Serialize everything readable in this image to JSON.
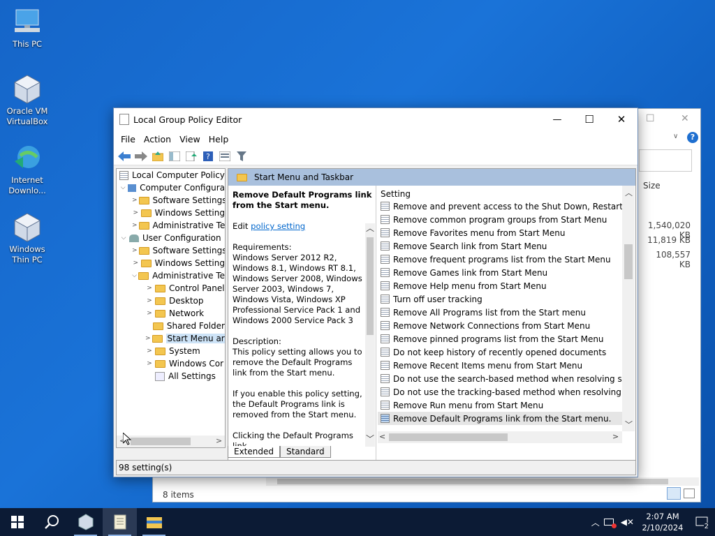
{
  "desktop_icons": [
    {
      "label1": "This PC",
      "label2": ""
    },
    {
      "label1": "Oracle VM",
      "label2": "VirtualBox"
    },
    {
      "label1": "Internet",
      "label2": "Downlo..."
    },
    {
      "label1": "Windows",
      "label2": "Thin PC"
    }
  ],
  "bg_window": {
    "col_size": "Size",
    "sizes": [
      "1,540,020 KB",
      "11,819 KB",
      "108,557 KB"
    ],
    "status": "8 items"
  },
  "window": {
    "title": "Local Group Policy Editor",
    "min": "—",
    "max": "☐",
    "close": "✕"
  },
  "menu": [
    "File",
    "Action",
    "View",
    "Help"
  ],
  "tree": {
    "root": "Local Computer Policy",
    "computer": "Computer Configura",
    "c_sw": "Software Settings",
    "c_win": "Windows Setting",
    "c_adm": "Administrative Te",
    "user": "User Configuration",
    "u_sw": "Software Settings",
    "u_win": "Windows Setting",
    "u_adm": "Administrative Te",
    "children": [
      "Control Panel",
      "Desktop",
      "Network",
      "Shared Folder",
      "Start Menu ar",
      "System",
      "Windows Cor",
      "All Settings"
    ]
  },
  "pane": {
    "header": "Start Menu and Taskbar",
    "desc_title": "Remove Default Programs link from the Start menu.",
    "edit_prefix": "Edit ",
    "edit_link": "policy setting",
    "req_label": "Requirements:",
    "requirements": "Windows Server 2012 R2, Windows 8.1, Windows RT 8.1, Windows Server 2008, Windows Server 2003, Windows 7, Windows Vista, Windows XP Professional Service Pack 1 and Windows 2000 Service Pack 3",
    "desc_label": "Description:",
    "description": "This policy setting allows you to remove the Default Programs link from the Start menu.",
    "enable_text": "If you enable this policy setting, the Default Programs link is removed from the Start menu.",
    "click_text": "Clicking the Default Programs link",
    "col_setting": "Setting",
    "settings": [
      "Remove and prevent access to the Shut Down, Restart, Sleep...",
      "Remove common program groups from Start Menu",
      "Remove Favorites menu from Start Menu",
      "Remove Search link from Start Menu",
      "Remove frequent programs list from the Start Menu",
      "Remove Games link from Start Menu",
      "Remove Help menu from Start Menu",
      "Turn off user tracking",
      "Remove All Programs list from the Start menu",
      "Remove Network Connections from Start Menu",
      "Remove pinned programs list from the Start Menu",
      "Do not keep history of recently opened documents",
      "Remove Recent Items menu from Start Menu",
      "Do not use the search-based method when resolving shell s...",
      "Do not use the tracking-based method when resolving shell ...",
      "Remove Run menu from Start Menu",
      "Remove Default Programs link from the Start menu."
    ],
    "selected_index": 16,
    "tab_extended": "Extended",
    "tab_standard": "Standard"
  },
  "status": "98 setting(s)",
  "taskbar": {
    "time": "2:07 AM",
    "date": "2/10/2024",
    "notif": "2"
  }
}
